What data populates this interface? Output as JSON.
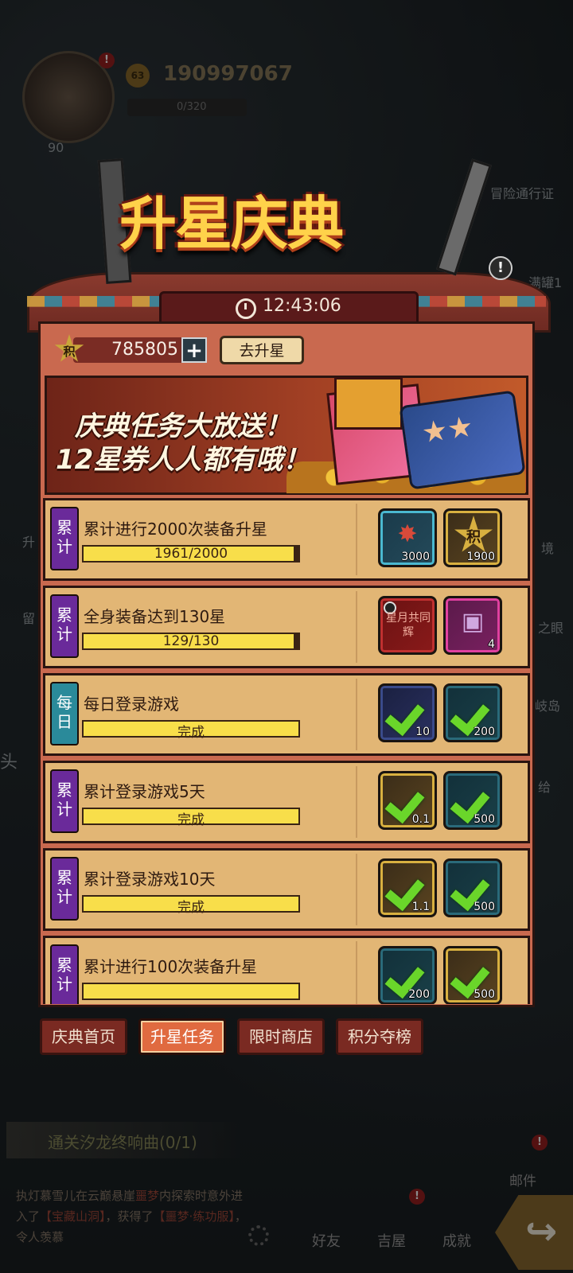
{
  "player": {
    "level": "90",
    "coins_badge": "63",
    "coins": "190997067",
    "energy": "0/320"
  },
  "side_menu": {
    "left": [
      "升",
      "留",
      "头"
    ],
    "right": [
      "冒险通行证",
      "满罐1",
      "境",
      "之眼",
      "岐岛",
      "给"
    ]
  },
  "event": {
    "title": "升星庆典",
    "timer": "12:43:06",
    "score_badge": "积",
    "score": "785805",
    "plus": "+",
    "go_star_button": "去升星",
    "banner_line1": "庆典任务大放送！",
    "banner_line2": "12星券人人都有哦！"
  },
  "tasks": [
    {
      "tag": "累计",
      "tag_color": "#6a2a9a",
      "title": "累计进行2000次装备升星",
      "progress": "1961/2000",
      "progress_ratio": 0.98,
      "rewards": [
        {
          "kind": "item",
          "count": "3000",
          "style": "blue"
        },
        {
          "kind": "points",
          "label": "积",
          "count": "1900",
          "style": "gold"
        }
      ]
    },
    {
      "tag": "累计",
      "tag_color": "#6a2a9a",
      "title": "全身装备达到130星",
      "progress": "129/130",
      "progress_ratio": 0.99,
      "rewards": [
        {
          "kind": "title",
          "label": "星月共同辉",
          "style": "red"
        },
        {
          "kind": "chest",
          "count": "4",
          "style": "magenta"
        }
      ]
    },
    {
      "tag": "每日",
      "tag_color": "#2a8a9a",
      "title": "每日登录游戏",
      "progress": "完成",
      "progress_ratio": 1,
      "rewards": [
        {
          "kind": "claimed",
          "count": "10",
          "style": "navy"
        },
        {
          "kind": "claimed",
          "count": "200",
          "style": "teal"
        }
      ]
    },
    {
      "tag": "累计",
      "tag_color": "#6a2a9a",
      "title": "累计登录游戏5天",
      "progress": "完成",
      "progress_ratio": 1,
      "rewards": [
        {
          "kind": "claimed",
          "count": "0.1",
          "style": "gold"
        },
        {
          "kind": "claimed",
          "count": "500",
          "style": "teal"
        }
      ]
    },
    {
      "tag": "累计",
      "tag_color": "#6a2a9a",
      "title": "累计登录游戏10天",
      "progress": "完成",
      "progress_ratio": 1,
      "rewards": [
        {
          "kind": "claimed",
          "count": "1.1",
          "style": "gold"
        },
        {
          "kind": "claimed",
          "count": "500",
          "style": "teal"
        }
      ]
    },
    {
      "tag": "累计",
      "tag_color": "#6a2a9a",
      "title": "累计进行100次装备升星",
      "progress": "",
      "progress_ratio": 1,
      "rewards": [
        {
          "kind": "claimed",
          "count": "200",
          "style": "teal"
        },
        {
          "kind": "claimed",
          "count": "500",
          "style": "gold"
        }
      ]
    }
  ],
  "tabs": [
    "庆典首页",
    "升星任务",
    "限时商店",
    "积分夺榜"
  ],
  "active_tab": 1,
  "bottom": {
    "quest": "通关汐龙终响曲(0/1)",
    "chat_prefix": "执灯慕雪儿在云巅悬崖",
    "chat_mid1": "噩梦",
    "chat_mid2": "内探索时意外进入了",
    "chat_place": "【宝藏山洞】",
    "chat_mid3": "，获得了",
    "chat_item": "【噩梦·练功服】",
    "chat_end": "，令人羡慕",
    "mail": "邮件",
    "friends": "好友",
    "shop": "吉屋",
    "achievements": "成就"
  }
}
